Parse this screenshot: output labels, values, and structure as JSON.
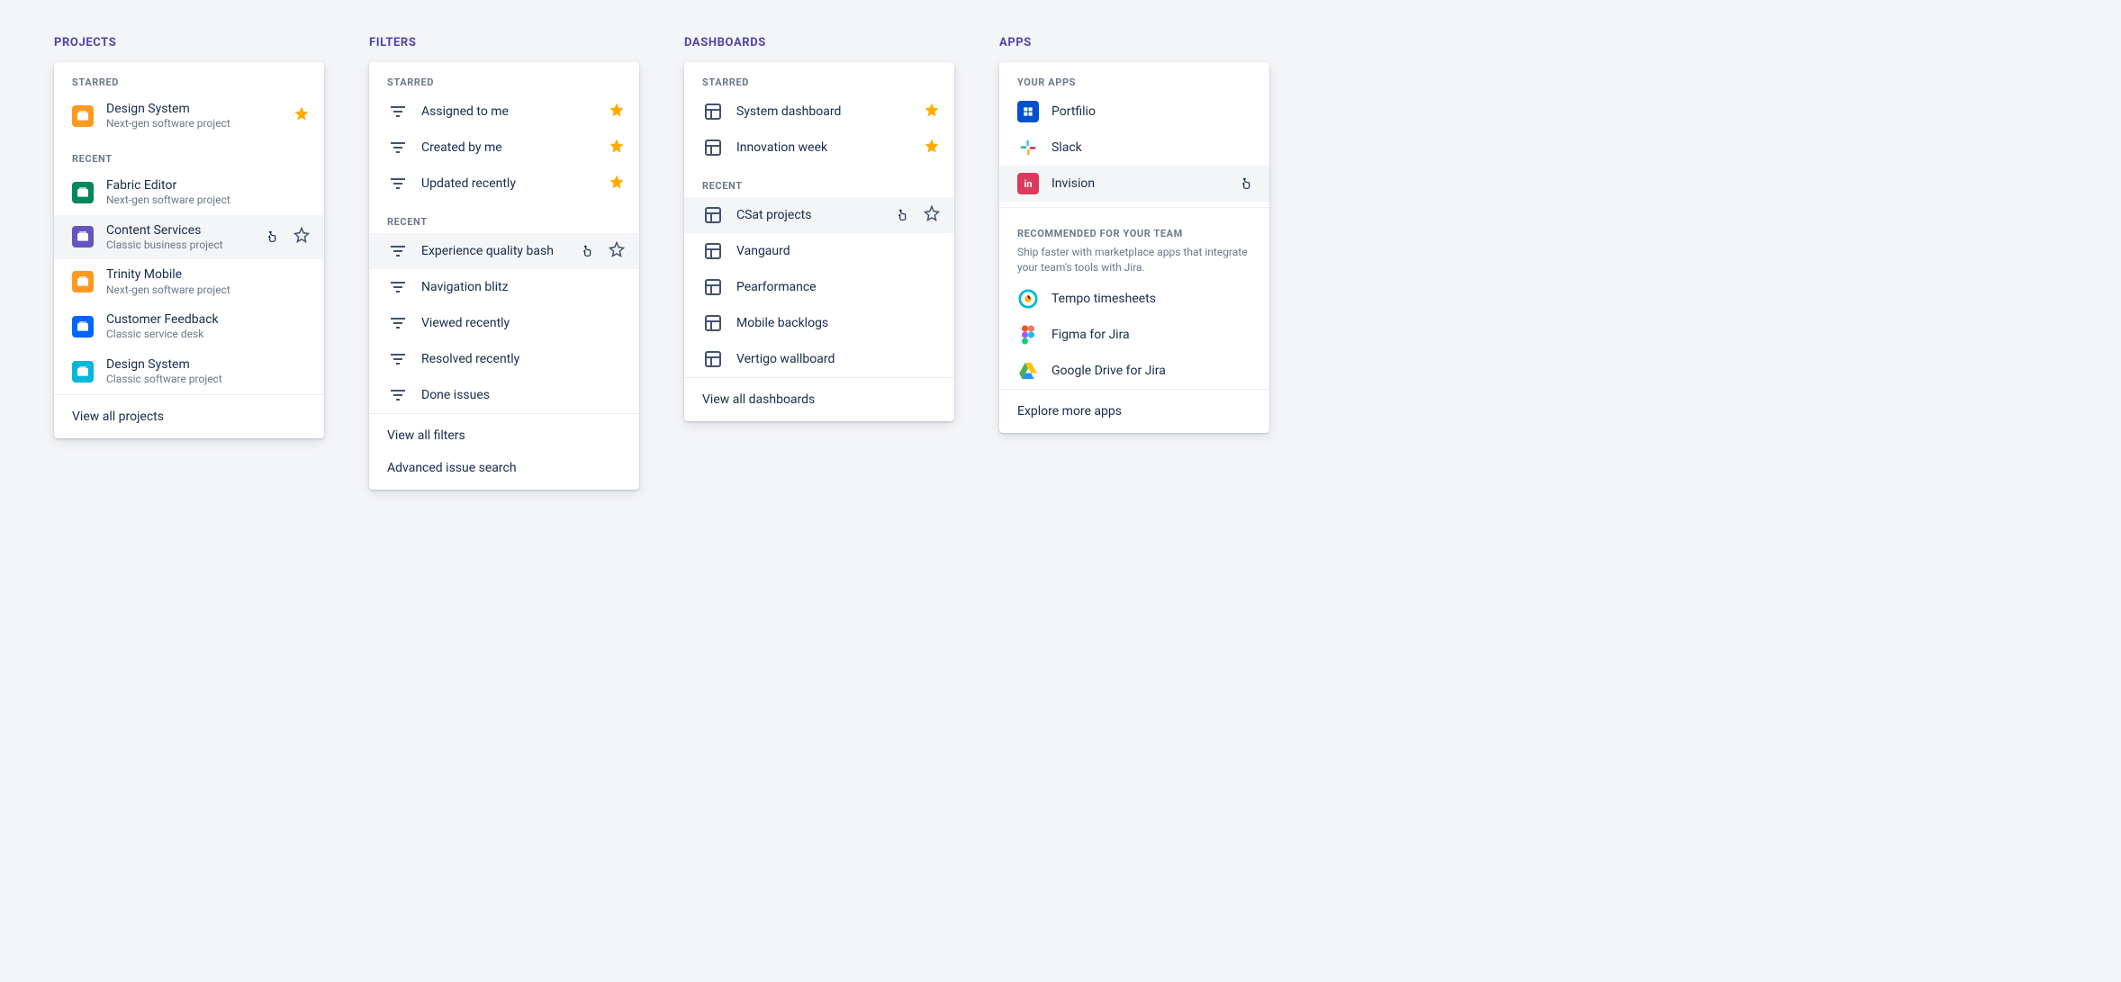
{
  "projects": {
    "title": "PROJECTS",
    "starred_label": "STARRED",
    "recent_label": "RECENT",
    "starred": [
      {
        "name": "Design System",
        "sub": "Next-gen software project",
        "icon_bg": "#ff991f"
      }
    ],
    "recent": [
      {
        "name": "Fabric Editor",
        "sub": "Next-gen software project",
        "icon_bg": "#00875a"
      },
      {
        "name": "Content Services",
        "sub": "Classic business project",
        "icon_bg": "#6554c0",
        "hover": true,
        "star_outline": true
      },
      {
        "name": "Trinity Mobile",
        "sub": "Next-gen software project",
        "icon_bg": "#ff991f"
      },
      {
        "name": "Customer Feedback",
        "sub": "Classic service desk",
        "icon_bg": "#0065ff"
      },
      {
        "name": "Design System",
        "sub": "Classic software project",
        "icon_bg": "#00b8d9"
      }
    ],
    "footer": [
      "View all projects"
    ]
  },
  "filters": {
    "title": "FILTERS",
    "starred_label": "STARRED",
    "recent_label": "RECENT",
    "starred": [
      {
        "name": "Assigned to me"
      },
      {
        "name": "Created by me"
      },
      {
        "name": "Updated recently"
      }
    ],
    "recent": [
      {
        "name": "Experience quality bash",
        "hover": true,
        "star_outline": true
      },
      {
        "name": "Navigation blitz"
      },
      {
        "name": "Viewed recently"
      },
      {
        "name": "Resolved recently"
      },
      {
        "name": "Done issues"
      }
    ],
    "footer": [
      "View all filters",
      "Advanced issue search"
    ]
  },
  "dashboards": {
    "title": "DASHBOARDS",
    "starred_label": "STARRED",
    "recent_label": "RECENT",
    "starred": [
      {
        "name": "System dashboard"
      },
      {
        "name": "Innovation week"
      }
    ],
    "recent": [
      {
        "name": "CSat projects",
        "hover": true,
        "star_outline": true
      },
      {
        "name": "Vangaurd"
      },
      {
        "name": "Pearformance"
      },
      {
        "name": "Mobile backlogs"
      },
      {
        "name": "Vertigo wallboard"
      }
    ],
    "footer": [
      "View all dashboards"
    ]
  },
  "apps": {
    "title": "APPS",
    "your_apps_label": "YOUR APPS",
    "your_apps": [
      {
        "name": "Portfilio",
        "kind": "portfolio"
      },
      {
        "name": "Slack",
        "kind": "slack"
      },
      {
        "name": "Invision",
        "kind": "invision",
        "hover": true
      }
    ],
    "rec_title": "RECOMMENDED FOR YOUR TEAM",
    "rec_desc": "Ship faster with marketplace apps that integrate your team's tools with Jira.",
    "recommended": [
      {
        "name": "Tempo timesheets",
        "kind": "tempo"
      },
      {
        "name": "Figma for Jira",
        "kind": "figma"
      },
      {
        "name": "Google Drive for Jira",
        "kind": "gdrive"
      }
    ],
    "footer": [
      "Explore more apps"
    ]
  }
}
